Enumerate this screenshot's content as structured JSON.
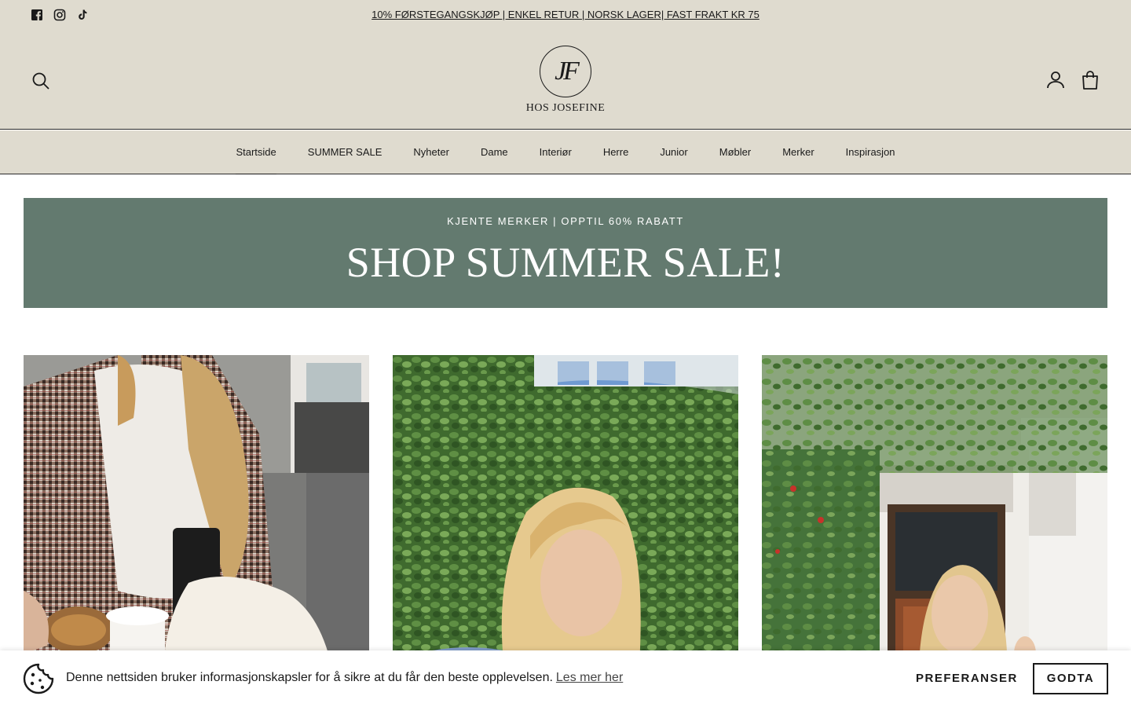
{
  "announcement": "10% FØRSTEGANGSKJØP | ENKEL RETUR | NORSK LAGER| FAST FRAKT KR 75",
  "social": [
    "facebook-icon",
    "instagram-icon",
    "tiktok-icon"
  ],
  "logo": {
    "monogram": "JF",
    "name": "HOS JOSEFINE"
  },
  "nav": {
    "items": [
      "Startside",
      "SUMMER SALE",
      "Nyheter",
      "Dame",
      "Interiør",
      "Herre",
      "Junior",
      "Møbler",
      "Merker",
      "Inspirasjon"
    ],
    "active": "Startside"
  },
  "promo": {
    "subtitle": "KJENTE MERKER | OPPTIL 60% RABATT",
    "title": "SHOP SUMMER SALE!",
    "background": "#637a6f"
  },
  "cookie": {
    "text": "Denne nettsiden bruker informasjonskapsler for å sikre at du får den beste opplevelsen.",
    "link": "Les mer her",
    "preferences": "PREFERANSER",
    "accept": "GODTA"
  },
  "colors": {
    "header_bg": "#dfdbcf",
    "text": "#1a1a1a"
  }
}
